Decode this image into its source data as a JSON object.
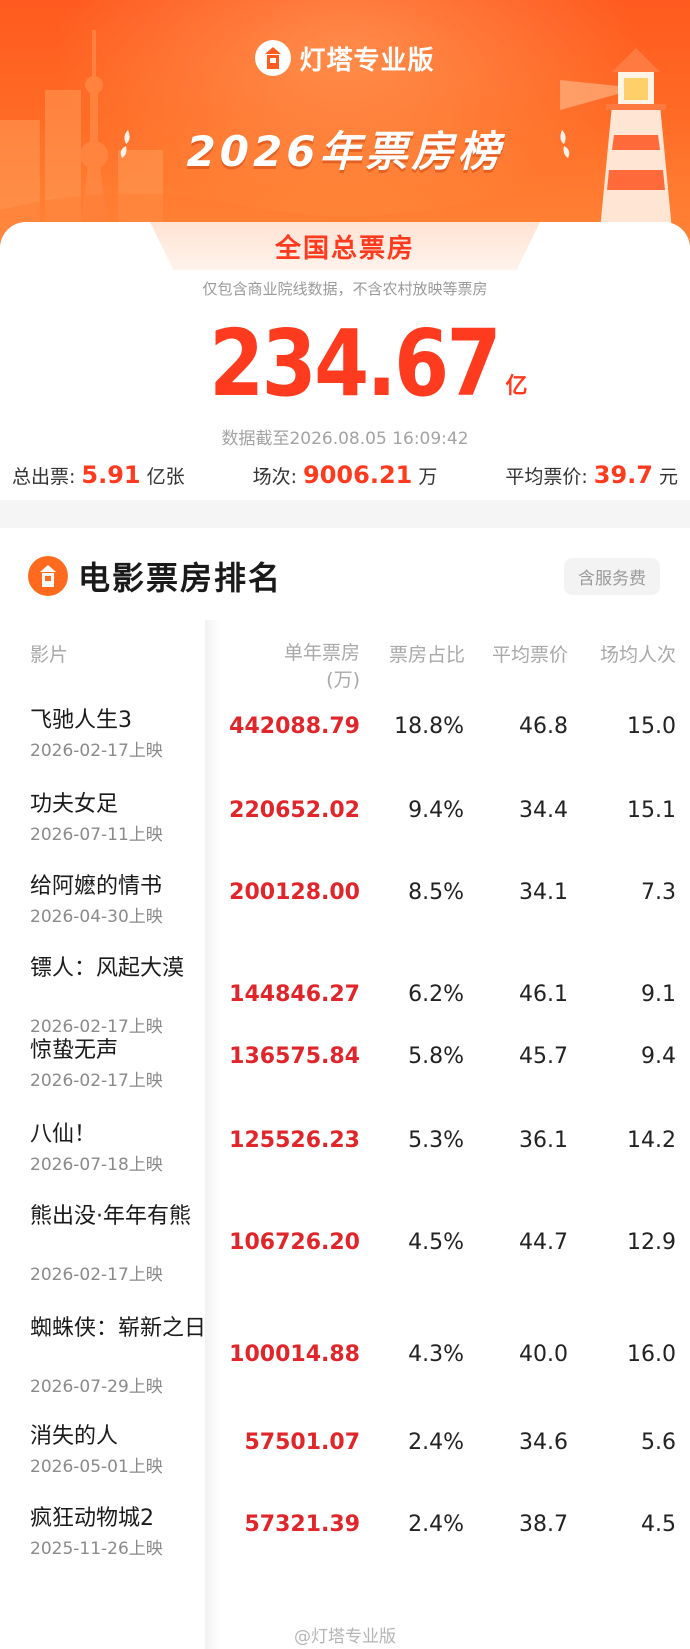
{
  "header": {
    "brand": "灯塔专业版",
    "title": "2026年票房榜",
    "brand_color": "#ff5a1f"
  },
  "summary": {
    "tab_label": "全国总票房",
    "note": "仅包含商业院线数据，不含农村放映等票房",
    "total": "234.67",
    "total_unit": "亿",
    "timestamp": "数据截至2026.08.05 16:09:42",
    "tickets_label": "总出票:",
    "tickets_value": "5.91",
    "tickets_unit": "亿张",
    "shows_label": "场次:",
    "shows_value": "9006.21",
    "shows_unit": "万",
    "avg_price_label": "平均票价:",
    "avg_price_value": "39.7",
    "avg_price_unit": "元"
  },
  "ranking": {
    "title": "电影票房排名",
    "fee_badge": "含服务费",
    "columns": {
      "film": "影片",
      "box_office": "单年票房",
      "box_office_unit": "(万)",
      "share": "票房占比",
      "avg_price": "平均票价",
      "avg_attendance": "场均人次"
    },
    "rows": [
      {
        "name": "飞驰人生3",
        "date": "2026-02-17上映",
        "box": "442088.79",
        "share": "18.8%",
        "price": "46.8",
        "avg": "15.0"
      },
      {
        "name": "功夫女足",
        "date": "2026-07-11上映",
        "box": "220652.02",
        "share": "9.4%",
        "price": "34.4",
        "avg": "15.1"
      },
      {
        "name": "给阿嬷的情书",
        "date": "2026-04-30上映",
        "box": "200128.00",
        "share": "8.5%",
        "price": "34.1",
        "avg": "7.3"
      },
      {
        "name": "镖人：风起大漠",
        "date": "2026-02-17上映",
        "box": "144846.27",
        "share": "6.2%",
        "price": "46.1",
        "avg": "9.1"
      },
      {
        "name": "惊蛰无声",
        "date": "2026-02-17上映",
        "box": "136575.84",
        "share": "5.8%",
        "price": "45.7",
        "avg": "9.4"
      },
      {
        "name": "八仙！",
        "date": "2026-07-18上映",
        "box": "125526.23",
        "share": "5.3%",
        "price": "36.1",
        "avg": "14.2"
      },
      {
        "name": "熊出没·年年有熊",
        "date": "2026-02-17上映",
        "box": "106726.20",
        "share": "4.5%",
        "price": "44.7",
        "avg": "12.9"
      },
      {
        "name": "蜘蛛侠：崭新之日",
        "date": "2026-07-29上映",
        "box": "100014.88",
        "share": "4.3%",
        "price": "40.0",
        "avg": "16.0"
      },
      {
        "name": "消失的人",
        "date": "2026-05-01上映",
        "box": "57501.07",
        "share": "2.4%",
        "price": "34.6",
        "avg": "5.6"
      },
      {
        "name": "疯狂动物城2",
        "date": "2025-11-26上映",
        "box": "57321.39",
        "share": "2.4%",
        "price": "38.7",
        "avg": "4.5"
      }
    ]
  },
  "watermark": "@灯塔专业版"
}
